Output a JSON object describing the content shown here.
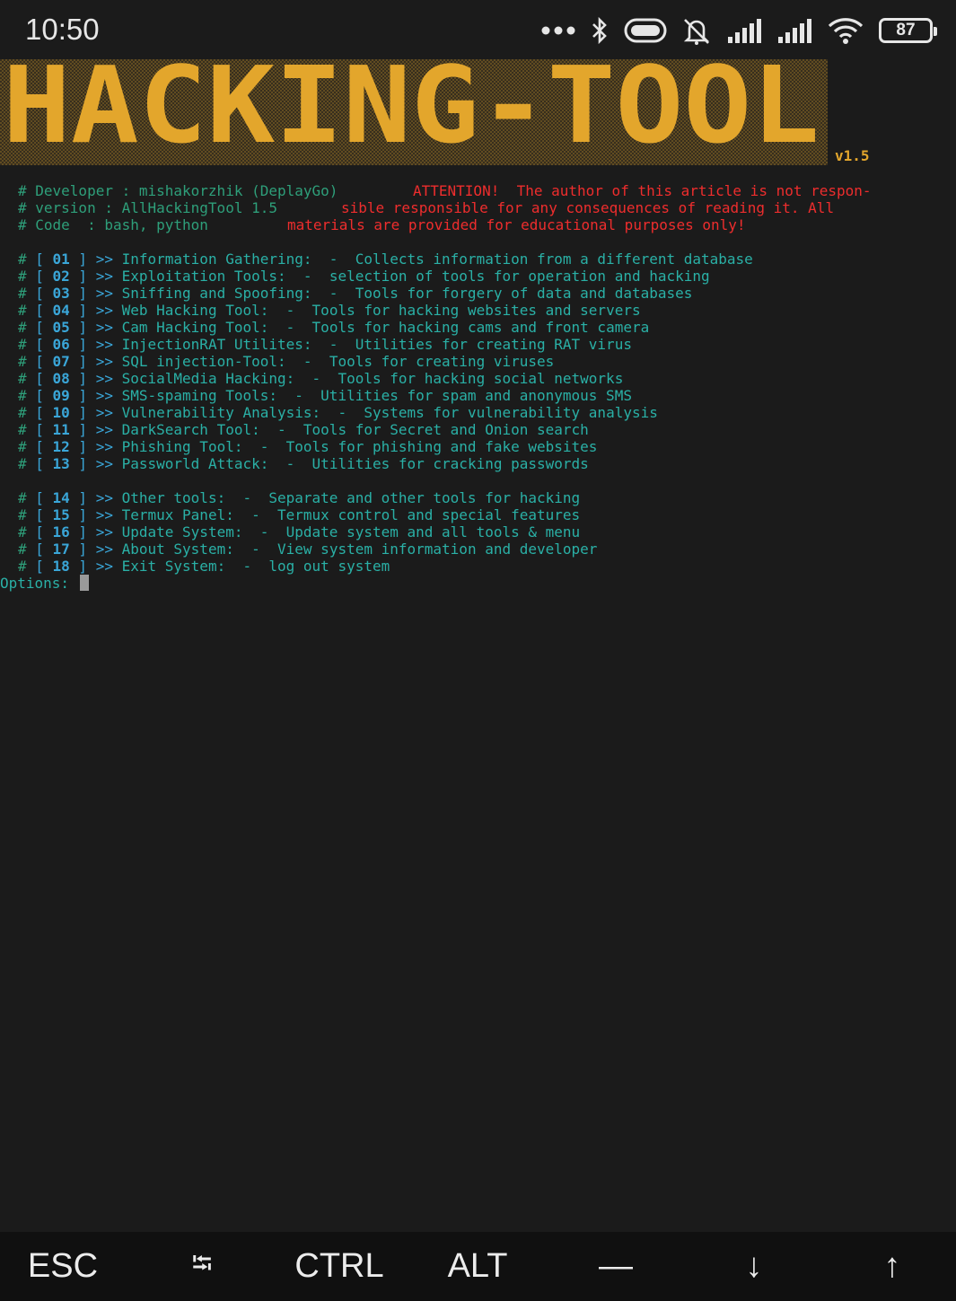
{
  "status_bar": {
    "time": "10:50",
    "battery": "87",
    "icons": [
      "more-dots-icon",
      "bluetooth-icon",
      "toggle-icon",
      "alarm-off-icon",
      "signal-icon",
      "signal-icon",
      "wifi-icon",
      "battery-icon"
    ]
  },
  "banner": {
    "title": "HACKING-TOOL",
    "version": "v1.5",
    "color": "#e3a62c"
  },
  "info": {
    "developer": "# Developer : mishakorzhik (DeplayGo)",
    "version": "# version : AllHackingTool 1.5",
    "code": "# Code  : bash, python",
    "attention": [
      "ATTENTION!  The author of this article is not respon-",
      "sible responsible for any consequences of reading it. All",
      "materials are provided for educational purposes only!"
    ]
  },
  "menu": [
    {
      "num": "01",
      "title": "Information Gathering:",
      "desc": "Collects information from a different database"
    },
    {
      "num": "02",
      "title": "Exploitation Tools:",
      "desc": "selection of tools for operation and hacking"
    },
    {
      "num": "03",
      "title": "Sniffing and Spoofing:",
      "desc": "Tools for forgery of data and databases"
    },
    {
      "num": "04",
      "title": "Web Hacking Tool:",
      "desc": "Tools for hacking websites and servers"
    },
    {
      "num": "05",
      "title": "Cam Hacking Tool:",
      "desc": "Tools for hacking cams and front camera"
    },
    {
      "num": "06",
      "title": "InjectionRAT Utilites:",
      "desc": "Utilities for creating RAT virus"
    },
    {
      "num": "07",
      "title": "SQL injection-Tool:",
      "desc": "Tools for creating viruses"
    },
    {
      "num": "08",
      "title": "SocialMedia Hacking:",
      "desc": "Tools for hacking social networks"
    },
    {
      "num": "09",
      "title": "SMS-spaming Tools:",
      "desc": "Utilities for spam and anonymous SMS"
    },
    {
      "num": "10",
      "title": "Vulnerability Analysis:",
      "desc": "Systems for vulnerability analysis"
    },
    {
      "num": "11",
      "title": "DarkSearch Tool:",
      "desc": "Tools for Secret and Onion search"
    },
    {
      "num": "12",
      "title": "Phishing Tool:",
      "desc": "Tools for phishing and fake websites"
    },
    {
      "num": "13",
      "title": "Passworld Attack:",
      "desc": "Utilities for cracking passwords"
    }
  ],
  "menu2": [
    {
      "num": "14",
      "title": "Other tools:",
      "desc": "Separate and other tools for hacking"
    },
    {
      "num": "15",
      "title": "Termux Panel:",
      "desc": "Termux control and special features"
    },
    {
      "num": "16",
      "title": "Update System:",
      "desc": "Update system and all tools & menu"
    },
    {
      "num": "17",
      "title": "About System:",
      "desc": "View system information and developer"
    },
    {
      "num": "18",
      "title": "Exit System:",
      "desc": "log out system"
    }
  ],
  "prompt": "Options:",
  "keys": [
    "ESC",
    "⭾",
    "CTRL",
    "ALT",
    "—",
    "↓",
    "↑"
  ]
}
